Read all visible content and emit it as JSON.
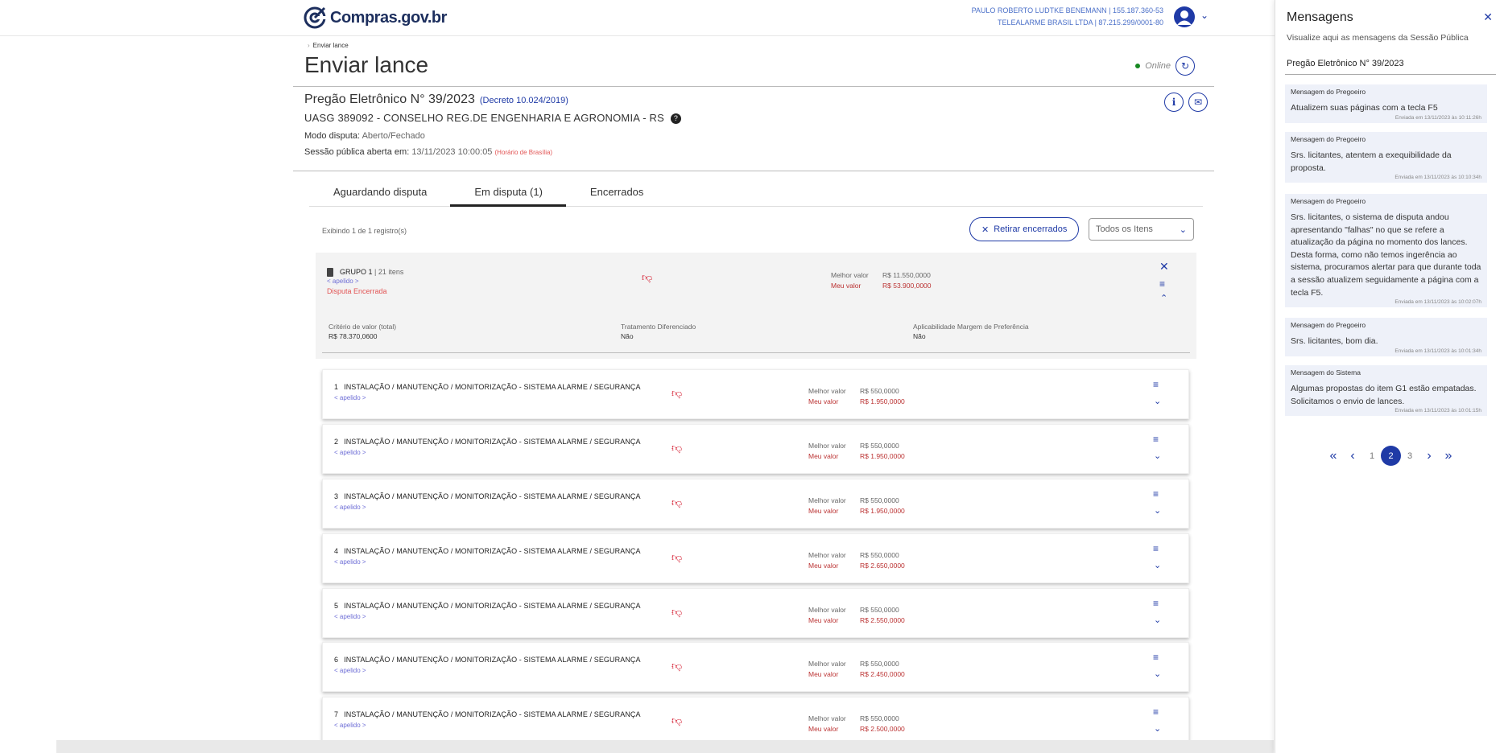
{
  "header": {
    "brand_name": "Compras",
    "brand_domain": ".gov.br",
    "user_name": "PAULO ROBERTO LUDTKE BENEMANN | 155.187.360-53",
    "user_company": "TELEALARME BRASIL LTDA | 87.215.299/0001-80"
  },
  "page": {
    "breadcrumb": "Enviar lance",
    "title": "Enviar lance",
    "status": "Online"
  },
  "pregao": {
    "title": "Pregão Eletrônico N° 39/2023",
    "decreto": "(Decreto 10.024/2019)",
    "uasg": "UASG 389092 - CONSELHO REG.DE ENGENHARIA E AGRONOMIA - RS",
    "modo_label": "Modo disputa:",
    "modo_value": "Aberto/Fechado",
    "sessao_label": "Sessão pública aberta em:",
    "sessao_value": "13/11/2023 10:00:05",
    "sessao_tz": "(Horário de Brasília)"
  },
  "tabs": [
    {
      "label": "Aguardando disputa"
    },
    {
      "label": "Em disputa (1)"
    },
    {
      "label": "Encerrados"
    }
  ],
  "toolbar": {
    "records": "Exibindo 1 de 1 registro(s)",
    "retirar_label": "Retirar encerrados",
    "filter_value": "Todos os Itens"
  },
  "group": {
    "name": "GRUPO 1",
    "count": "21 itens",
    "apelido": "< apelido >",
    "status": "Disputa Encerrada",
    "melhor_label": "Melhor valor",
    "melhor_value": "R$ 11.550,0000",
    "meu_label": "Meu valor",
    "meu_value": "R$ 53.900,0000",
    "criterio_label": "Critério de valor (total)",
    "criterio_value": "R$ 78.370,0600",
    "tratamento_label": "Tratamento Diferenciado",
    "tratamento_value": "Não",
    "margem_label": "Aplicabilidade Margem de Preferência",
    "margem_value": "Não"
  },
  "items": [
    {
      "num": "1",
      "title": "INSTALAÇÃO / MANUTENÇÃO / MONITORIZAÇÃO - SISTEMA ALARME / SEGURANÇA",
      "apelido": "< apelido >",
      "melhor_label": "Melhor valor",
      "melhor": "R$ 550,0000",
      "meu_label": "Meu valor",
      "meu": "R$ 1.950,0000"
    },
    {
      "num": "2",
      "title": "INSTALAÇÃO / MANUTENÇÃO / MONITORIZAÇÃO - SISTEMA ALARME / SEGURANÇA",
      "apelido": "< apelido >",
      "melhor_label": "Melhor valor",
      "melhor": "R$ 550,0000",
      "meu_label": "Meu valor",
      "meu": "R$ 1.950,0000"
    },
    {
      "num": "3",
      "title": "INSTALAÇÃO / MANUTENÇÃO / MONITORIZAÇÃO - SISTEMA ALARME / SEGURANÇA",
      "apelido": "< apelido >",
      "melhor_label": "Melhor valor",
      "melhor": "R$ 550,0000",
      "meu_label": "Meu valor",
      "meu": "R$ 1.950,0000"
    },
    {
      "num": "4",
      "title": "INSTALAÇÃO / MANUTENÇÃO / MONITORIZAÇÃO - SISTEMA ALARME / SEGURANÇA",
      "apelido": "< apelido >",
      "melhor_label": "Melhor valor",
      "melhor": "R$ 550,0000",
      "meu_label": "Meu valor",
      "meu": "R$ 2.650,0000"
    },
    {
      "num": "5",
      "title": "INSTALAÇÃO / MANUTENÇÃO / MONITORIZAÇÃO - SISTEMA ALARME / SEGURANÇA",
      "apelido": "< apelido >",
      "melhor_label": "Melhor valor",
      "melhor": "R$ 550,0000",
      "meu_label": "Meu valor",
      "meu": "R$ 2.550,0000"
    },
    {
      "num": "6",
      "title": "INSTALAÇÃO / MANUTENÇÃO / MONITORIZAÇÃO - SISTEMA ALARME / SEGURANÇA",
      "apelido": "< apelido >",
      "melhor_label": "Melhor valor",
      "melhor": "R$ 550,0000",
      "meu_label": "Meu valor",
      "meu": "R$ 2.450,0000"
    },
    {
      "num": "7",
      "title": "INSTALAÇÃO / MANUTENÇÃO / MONITORIZAÇÃO - SISTEMA ALARME / SEGURANÇA",
      "apelido": "< apelido >",
      "melhor_label": "Melhor valor",
      "melhor": "R$ 550,0000",
      "meu_label": "Meu valor",
      "meu": "R$ 2.500,0000"
    }
  ],
  "panel": {
    "title": "Mensagens",
    "subtitle": "Visualize aqui as mensagens da Sessão Pública",
    "pregao": "Pregão Eletrônico N° 39/2023",
    "messages": [
      {
        "from": "Mensagem do Pregoeiro",
        "body": "Atualizem suas páginas com a tecla F5",
        "time": "Enviada em 13/11/2023 às 10:11:26h"
      },
      {
        "from": "Mensagem do Pregoeiro",
        "body": "Srs. licitantes, atentem a exequibilidade da proposta.",
        "time": "Enviada em 13/11/2023 às 10:10:34h"
      },
      {
        "from": "Mensagem do Pregoeiro",
        "body": "Srs. licitantes, o sistema de disputa andou apresentando \"falhas\" no que se refere a atualização da página no momento dos lances. Desta forma, como não temos ingerência ao sistema, procuramos alertar para que durante toda a sessão atualizem seguidamente a página com a tecla F5.",
        "time": "Enviada em 13/11/2023 às 10:02:07h"
      },
      {
        "from": "Mensagem do Pregoeiro",
        "body": "Srs. licitantes, bom dia.",
        "time": "Enviada em 13/11/2023 às 10:01:34h"
      },
      {
        "from": "Mensagem do Sistema",
        "body": "Algumas propostas do item G1 estão empatadas. Solicitamos o envio de lances.",
        "time": "Enviada em 13/11/2023 às 10:01:15h"
      }
    ],
    "pager": {
      "first": "«",
      "prev": "‹",
      "pages": [
        "1",
        "2",
        "3"
      ],
      "current": "2",
      "next": "›",
      "last": "»"
    }
  },
  "colors": {
    "primary": "#1f3aa6",
    "danger": "#d4192d",
    "online": "#168821"
  }
}
